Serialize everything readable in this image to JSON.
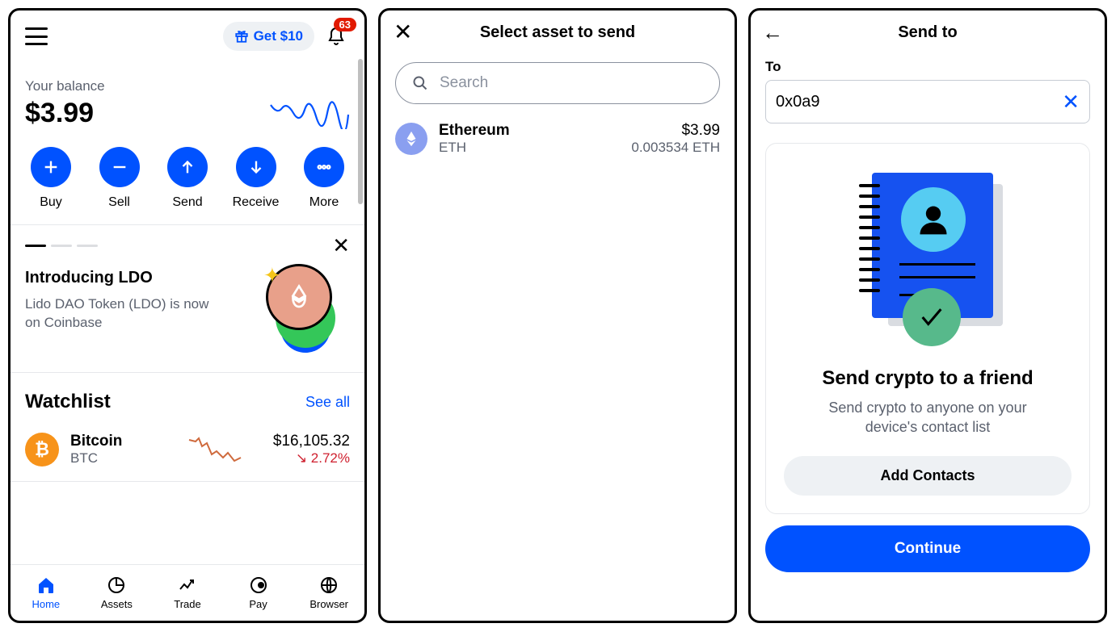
{
  "screen1": {
    "promo_pill": "Get $10",
    "notif_count": "63",
    "balance_label": "Your balance",
    "balance_amount": "$3.99",
    "actions": {
      "buy": "Buy",
      "sell": "Sell",
      "send": "Send",
      "receive": "Receive",
      "more": "More"
    },
    "card": {
      "title": "Introducing LDO",
      "desc": "Lido DAO Token (LDO) is now on Coinbase"
    },
    "watchlist_title": "Watchlist",
    "see_all": "See all",
    "btc": {
      "name": "Bitcoin",
      "sym": "BTC",
      "price": "$16,105.32",
      "change": "↘ 2.72%"
    },
    "tabs": {
      "home": "Home",
      "assets": "Assets",
      "trade": "Trade",
      "pay": "Pay",
      "browser": "Browser"
    }
  },
  "screen2": {
    "title": "Select asset to send",
    "search_placeholder": "Search",
    "eth": {
      "name": "Ethereum",
      "sym": "ETH",
      "fiat": "$3.99",
      "qty": "0.003534 ETH"
    }
  },
  "screen3": {
    "title": "Send to",
    "to_label": "To",
    "address_value": "0x0a9",
    "friend_title": "Send crypto to a friend",
    "friend_desc": "Send crypto to anyone on your device's contact list",
    "add_contacts": "Add Contacts",
    "continue": "Continue"
  }
}
